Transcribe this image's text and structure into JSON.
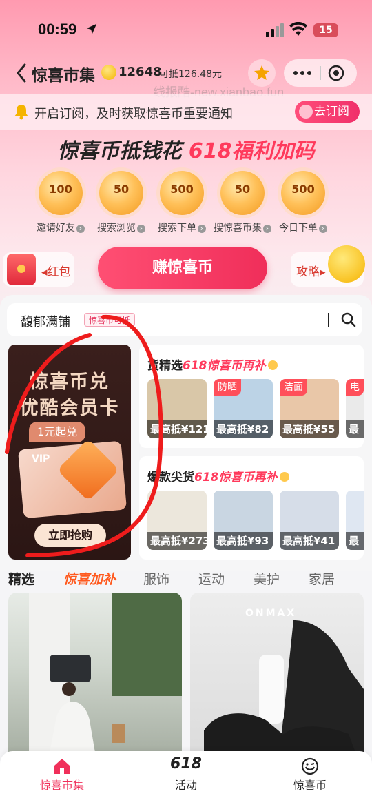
{
  "status_bar": {
    "time": "00:59",
    "battery": "15"
  },
  "navbar": {
    "title": "惊喜市集",
    "coins": "12648",
    "deduct": "可抵126.48元"
  },
  "watermark": "线报酷-new.xianbao.fun",
  "notice": {
    "text": "开启订阅，及时获取惊喜币重要通知",
    "button": "去订阅"
  },
  "headline": {
    "main": "惊喜币抵钱花",
    "accent": "618福利加码"
  },
  "tasks": [
    {
      "value": "100",
      "label": "邀请好友"
    },
    {
      "value": "50",
      "label": "搜索浏览"
    },
    {
      "value": "500",
      "label": "搜索下单"
    },
    {
      "value": "50",
      "label": "搜惊喜币集"
    },
    {
      "value": "500",
      "label": "今日下单"
    }
  ],
  "actions": {
    "redpack": "红包",
    "earn": "赚惊喜币",
    "strategy": "攻略"
  },
  "search": {
    "keyword": "馥郁满铺",
    "tag": "惊喜币可抵"
  },
  "promo": {
    "line1": "惊喜币兑",
    "line2": "优酷会员卡",
    "price_tag": "1元起兑",
    "vip": "VIP",
    "button": "立即抢购"
  },
  "sections": [
    {
      "title_pre": "货精选",
      "title_accent": "618惊喜币再补",
      "products": [
        {
          "badge": "",
          "price": "最高抵¥121",
          "color": "#d9c7a8"
        },
        {
          "badge": "防晒",
          "price": "最高抵¥82",
          "color": "#bcd3e6"
        },
        {
          "badge": "洁面",
          "price": "最高抵¥55",
          "color": "#e9c7a8"
        },
        {
          "badge": "电",
          "price": "最",
          "color": "#eaeaea"
        }
      ]
    },
    {
      "title_pre": "爆款尖货",
      "title_accent": "618惊喜币再补",
      "products": [
        {
          "badge": "",
          "price": "最高抵¥273",
          "color": "#ece7dc"
        },
        {
          "badge": "",
          "price": "最高抵¥93",
          "color": "#c9d6e2"
        },
        {
          "badge": "",
          "price": "最高抵¥41",
          "color": "#d6dde8"
        },
        {
          "badge": "",
          "price": "最",
          "color": "#dfe7f2"
        }
      ]
    }
  ],
  "categories": [
    {
      "label": "精选",
      "state": "active"
    },
    {
      "label": "惊喜加补",
      "state": "hot"
    },
    {
      "label": "服饰",
      "state": ""
    },
    {
      "label": "运动",
      "state": ""
    },
    {
      "label": "美护",
      "state": ""
    },
    {
      "label": "家居",
      "state": ""
    }
  ],
  "feed": {
    "brand": "ONMAX"
  },
  "tabbar": [
    {
      "label": "惊喜市集",
      "icon": "home-icon"
    },
    {
      "label": "活动",
      "icon": "618-icon",
      "glyph": "618"
    },
    {
      "label": "惊喜币",
      "icon": "coin-smile-icon"
    }
  ],
  "colors": {
    "accent": "#f0305a",
    "hot": "#ff5a1f",
    "coin": "#f4b400"
  }
}
